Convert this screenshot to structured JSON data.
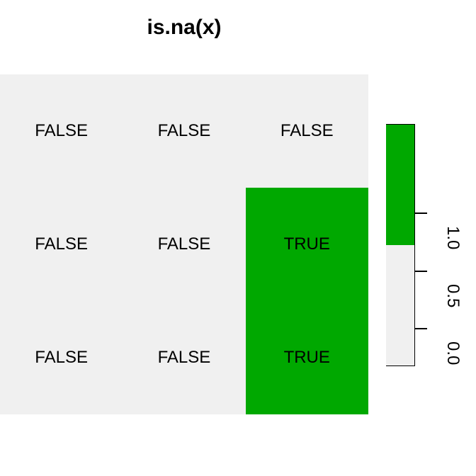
{
  "chart_data": {
    "type": "heatmap",
    "title": "is.na(x)",
    "nrow": 3,
    "ncol": 3,
    "values": [
      [
        "FALSE",
        "FALSE",
        "FALSE"
      ],
      [
        "FALSE",
        "FALSE",
        "TRUE"
      ],
      [
        "FALSE",
        "FALSE",
        "TRUE"
      ]
    ],
    "colors": {
      "FALSE": "#f0f0f0",
      "TRUE": "#00a800"
    },
    "legend": {
      "ticks": [
        "0.0",
        "0.5",
        "1.0"
      ],
      "range": [
        0,
        1
      ]
    }
  }
}
